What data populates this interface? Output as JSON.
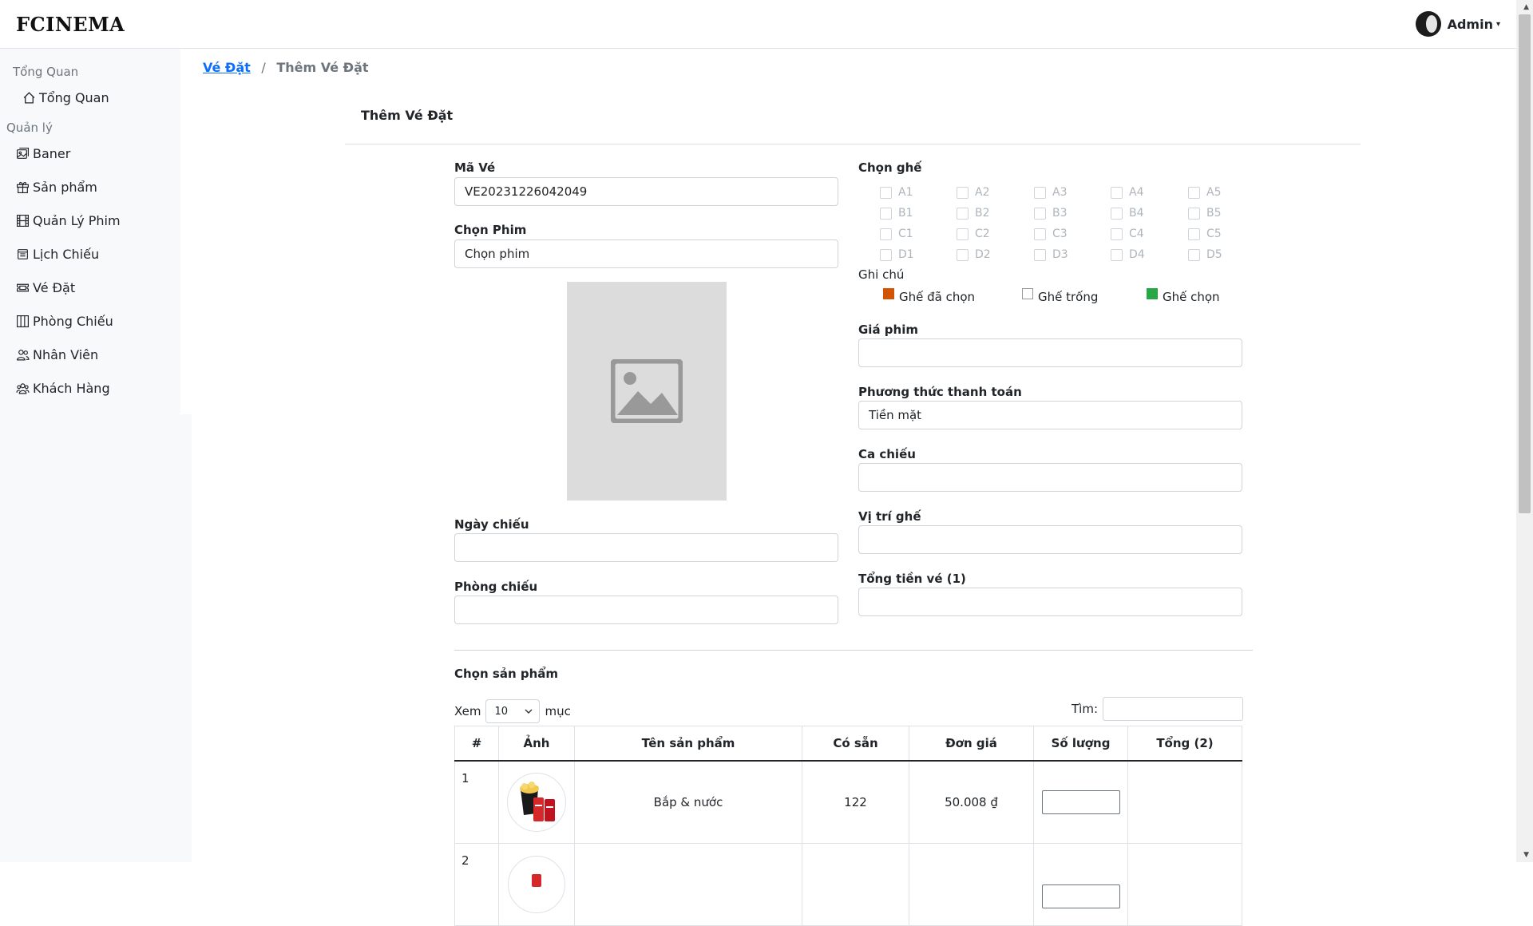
{
  "brand": "FCINEMA",
  "user": {
    "name": "Admin",
    "caret": "▾"
  },
  "sidebar": {
    "overview_heading": "Tổng Quan",
    "manage_heading": "Quản lý",
    "items": [
      {
        "label": "Tổng Quan",
        "icon": "house-icon"
      },
      {
        "label": "Baner",
        "icon": "images-icon"
      },
      {
        "label": "Sản phẩm",
        "icon": "gift-icon"
      },
      {
        "label": "Quản Lý Phim",
        "icon": "film-icon"
      },
      {
        "label": "Lịch Chiếu",
        "icon": "calendar-icon"
      },
      {
        "label": "Vé Đặt",
        "icon": "ticket-icon"
      },
      {
        "label": "Phòng Chiếu",
        "icon": "columns-icon"
      },
      {
        "label": "Nhân Viên",
        "icon": "people-icon"
      },
      {
        "label": "Khách Hàng",
        "icon": "people-group-icon"
      }
    ]
  },
  "breadcrumb": {
    "parent": "Vé Đặt",
    "separator": "/",
    "current": "Thêm Vé Đặt"
  },
  "card": {
    "title": "Thêm Vé Đặt"
  },
  "form": {
    "ma_ve": {
      "label": "Mã Vé",
      "value": "VE20231226042049"
    },
    "chon_phim": {
      "label": "Chọn Phim",
      "value": "Chọn phim"
    },
    "ngay_chieu": {
      "label": "Ngày chiếu",
      "value": ""
    },
    "phong_chieu": {
      "label": "Phòng chiếu",
      "value": ""
    },
    "chon_ghe": {
      "label": "Chọn ghế"
    },
    "ghi_chu": {
      "label": "Ghi chú"
    },
    "gia_phim": {
      "label": "Giá phim",
      "value": ""
    },
    "phuong_thuc": {
      "label": "Phương thức thanh toán",
      "value": "Tiền mặt"
    },
    "ca_chieu": {
      "label": "Ca chiếu",
      "value": ""
    },
    "vi_tri_ghe": {
      "label": "Vị trí ghế",
      "value": ""
    },
    "tong_tien_ve": {
      "label": "Tổng tiền vé (1)",
      "value": ""
    }
  },
  "seats": [
    [
      "A1",
      "A2",
      "A3",
      "A4",
      "A5"
    ],
    [
      "B1",
      "B2",
      "B3",
      "B4",
      "B5"
    ],
    [
      "C1",
      "C2",
      "C3",
      "C4",
      "C5"
    ],
    [
      "D1",
      "D2",
      "D3",
      "D4",
      "D5"
    ]
  ],
  "legend": [
    {
      "label": "Ghế đã chọn",
      "color": "#d35400"
    },
    {
      "label": "Ghế trống",
      "color": "#ffffff"
    },
    {
      "label": "Ghế chọn",
      "color": "#28a745"
    }
  ],
  "products": {
    "heading": "Chọn sản phẩm",
    "show_prefix": "Xem",
    "show_value": "10",
    "show_suffix": "mục",
    "search_label": "Tìm:",
    "columns": [
      "#",
      "Ảnh",
      "Tên sản phẩm",
      "Có sẵn",
      "Đơn giá",
      "Số lượng",
      "Tổng (2)"
    ],
    "rows": [
      {
        "num": "1",
        "name": "Bắp & nước",
        "stock": "122",
        "price": "50.008 ₫",
        "total": ""
      },
      {
        "num": "2",
        "name": "",
        "stock": "",
        "price": "",
        "total": ""
      }
    ]
  }
}
